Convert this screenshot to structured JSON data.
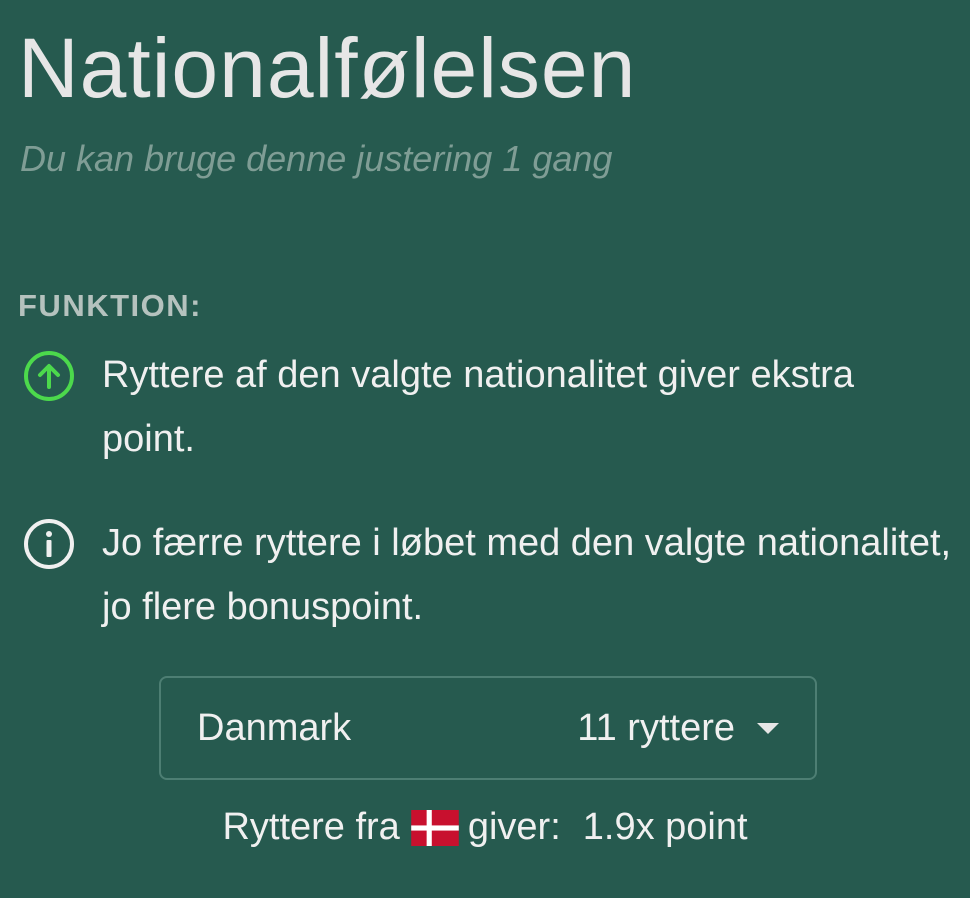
{
  "header": {
    "title": "Nationalfølelsen",
    "subtitle": "Du kan bruge denne justering 1 gang"
  },
  "function": {
    "label": "FUNKTION:",
    "items": [
      {
        "icon": "arrow-up-circle-icon",
        "text": "Ryttere af den valgte nationalitet giver ekstra point."
      },
      {
        "icon": "info-circle-icon",
        "text": "Jo færre ryttere i løbet med den valgte nationalitet, jo flere bonuspoint."
      }
    ]
  },
  "selector": {
    "country": "Danmark",
    "count": "11 ryttere"
  },
  "result": {
    "prefix": "Ryttere fra",
    "flag": "denmark-flag-icon",
    "verb": "giver:",
    "value": "1.9x point"
  },
  "colors": {
    "background": "#265a4f",
    "accent_green": "#4cd94c",
    "flag_red": "#c8102e"
  }
}
